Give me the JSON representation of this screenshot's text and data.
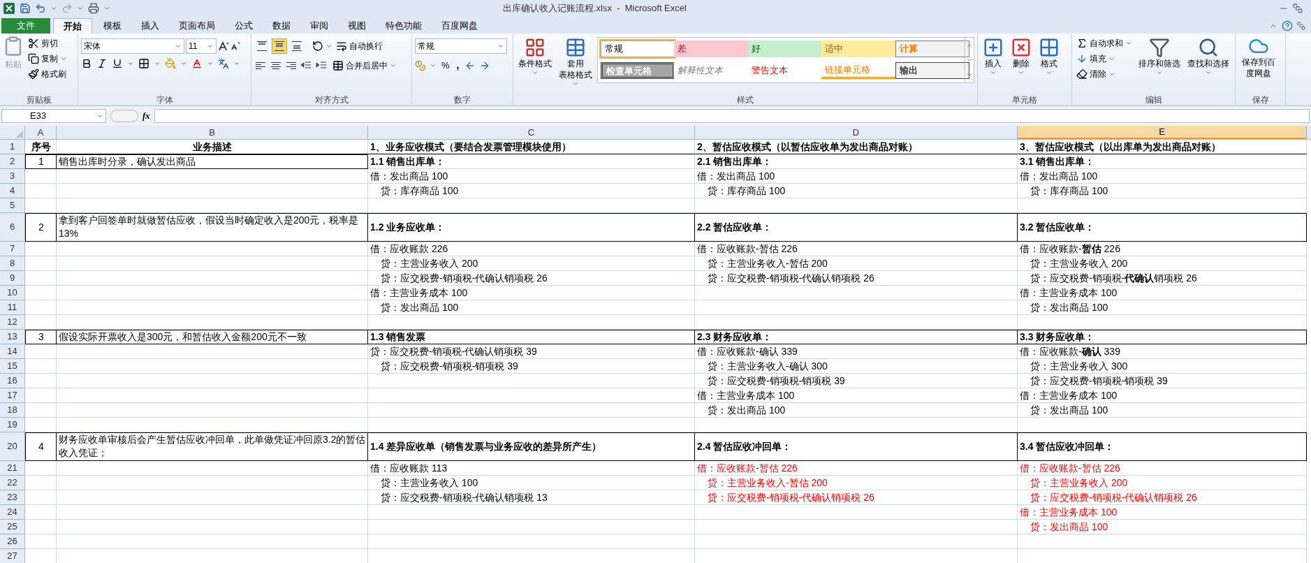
{
  "title_bar": {
    "title": "出库确认收入记账流程.xlsx  -  Microsoft Excel"
  },
  "tabs": [
    {
      "label": "文件",
      "kind": "file",
      "selected": false
    },
    {
      "label": "开始",
      "kind": "tab",
      "selected": true
    },
    {
      "label": "模板",
      "kind": "tab",
      "selected": false
    },
    {
      "label": "插入",
      "kind": "tab",
      "selected": false
    },
    {
      "label": "页面布局",
      "kind": "tab",
      "selected": false
    },
    {
      "label": "公式",
      "kind": "tab",
      "selected": false
    },
    {
      "label": "数据",
      "kind": "tab",
      "selected": false
    },
    {
      "label": "审阅",
      "kind": "tab",
      "selected": false
    },
    {
      "label": "视图",
      "kind": "tab",
      "selected": false
    },
    {
      "label": "特色功能",
      "kind": "tab",
      "selected": false
    },
    {
      "label": "百度网盘",
      "kind": "tab",
      "selected": false
    }
  ],
  "ribbon": {
    "clipboard": {
      "label": "剪贴板",
      "paste": "粘贴",
      "paste_disabled": true,
      "cut": "剪切",
      "copy": "复制",
      "format_painter": "格式刷"
    },
    "font": {
      "label": "字体",
      "font_name": "宋体",
      "font_size": "11"
    },
    "alignment": {
      "label": "对齐方式",
      "vertical_align": [
        {
          "kind": "top",
          "selected": false
        },
        {
          "kind": "middle",
          "selected": true
        },
        {
          "kind": "bottom",
          "selected": false
        }
      ],
      "wrap_text": "自动换行",
      "merge_center": "合并后居中"
    },
    "number": {
      "label": "数字",
      "format": "常规",
      "percent": "%",
      "comma": ","
    },
    "styles": {
      "label": "样式",
      "conditional_format": "条件格式",
      "table_format_line1": "套用",
      "table_format_line2": "表格格式",
      "cell_styles": [
        {
          "label": "常规",
          "kind": "normal",
          "selected": true
        },
        {
          "label": "差",
          "kind": "bad",
          "selected": false
        },
        {
          "label": "好",
          "kind": "good",
          "selected": false
        },
        {
          "label": "适中",
          "kind": "neutral",
          "selected": false
        },
        {
          "label": "计算",
          "kind": "calculation",
          "selected": false
        },
        {
          "label": "检查单元格",
          "kind": "check",
          "selected": false
        },
        {
          "label": "解释性文本",
          "kind": "explanatory",
          "selected": false
        },
        {
          "label": "警告文本",
          "kind": "warning",
          "selected": false
        },
        {
          "label": "链接单元格",
          "kind": "linked",
          "selected": false
        },
        {
          "label": "输出",
          "kind": "output",
          "selected": false
        }
      ]
    },
    "cells": {
      "label": "单元格",
      "insert": "插入",
      "delete": "删除",
      "format": "格式"
    },
    "editing": {
      "label": "编辑",
      "autosum": "自动求和",
      "fill": "填充",
      "clear": "清除",
      "sort_filter": "排序和筛选",
      "find_select": "查找和选择"
    },
    "save": {
      "label": "保存",
      "save_baidu": "保存到百度网盘"
    }
  },
  "formula_bar": {
    "name_box": "E33",
    "fx": "fx"
  },
  "sheet": {
    "columns": [
      {
        "label": "A",
        "selected": false
      },
      {
        "label": "B",
        "selected": false
      },
      {
        "label": "C",
        "selected": false
      },
      {
        "label": "D",
        "selected": false
      },
      {
        "label": "E",
        "selected": true
      }
    ],
    "rows": [
      {
        "n": "1",
        "kind": "title",
        "a": {
          "kind": "title",
          "text": "序号",
          "red": false
        },
        "b": {
          "kind": "title",
          "text": "业务描述",
          "red": false
        },
        "c": {
          "kind": "heading",
          "text": "1、业务应收模式（要结合发票管理模块使用）",
          "red": false
        },
        "d": {
          "kind": "heading",
          "text": "2、暂估应收模式（以暂估应收单为发出商品对账）",
          "red": false
        },
        "e": {
          "kind": "heading",
          "text": "3、暂估应收模式（以出库单为发出商品对账）",
          "red": false
        }
      },
      {
        "n": "2",
        "kind": "group",
        "a": {
          "kind": "number",
          "text": "1",
          "red": false
        },
        "b": {
          "kind": "text",
          "text": "销售出库时分录，确认发出商品",
          "red": false
        },
        "c": {
          "kind": "heading",
          "text": "1.1  销售出库单：",
          "red": false
        },
        "d": {
          "kind": "heading",
          "text": "2.1  销售出库单：",
          "red": false
        },
        "e": {
          "kind": "heading",
          "text": "3.1  销售出库单：",
          "red": false
        }
      },
      {
        "n": "3",
        "kind": "plain",
        "c": {
          "kind": "line",
          "text": "借：发出商品 100",
          "red": false
        },
        "d": {
          "kind": "line",
          "text": "借：发出商品 100",
          "red": false
        },
        "e": {
          "kind": "line",
          "text": "借：发出商品 100",
          "red": false
        }
      },
      {
        "n": "4",
        "kind": "plain",
        "c": {
          "kind": "subline",
          "text": "贷：库存商品 100",
          "red": false
        },
        "d": {
          "kind": "subline",
          "text": "贷：库存商品 100",
          "red": false
        },
        "e": {
          "kind": "subline",
          "text": "贷：库存商品 100",
          "red": false
        }
      },
      {
        "n": "5",
        "kind": "plain"
      },
      {
        "n": "6",
        "kind": "boxed_group",
        "a": {
          "kind": "number",
          "text": "2",
          "red": false
        },
        "b": {
          "kind": "text",
          "text": "拿到客户回签单时就做暂估应收，假设当时确定收入是200元，税率是13%",
          "red": false
        },
        "c": {
          "kind": "heading",
          "text": "1.2  业务应收单：",
          "red": false
        },
        "d": {
          "kind": "heading",
          "text": "2.2  暂估应收单：",
          "red": false
        },
        "e": {
          "kind": "heading",
          "text": "3.2  暂估应收单：",
          "red": false
        }
      },
      {
        "n": "7",
        "kind": "plain",
        "c": {
          "kind": "line",
          "text": "借：应收账款 226",
          "red": false
        },
        "d": {
          "kind": "line",
          "text": "借：应收账款-暂估 226",
          "red": false
        },
        "e": {
          "kind": "line",
          "text": "借：应收账款-**暂估** 226",
          "red": false
        }
      },
      {
        "n": "8",
        "kind": "plain",
        "c": {
          "kind": "subline",
          "text": "贷：主营业务收入 200",
          "red": false
        },
        "d": {
          "kind": "subline",
          "text": "贷：主营业务收入-暂估 200",
          "red": false
        },
        "e": {
          "kind": "subline",
          "text": "贷：主营业务收入 200",
          "red": false
        }
      },
      {
        "n": "9",
        "kind": "plain",
        "c": {
          "kind": "subline",
          "text": "贷：应交税费-销项税-代确认销项税 26",
          "red": false
        },
        "d": {
          "kind": "subline",
          "text": "贷：应交税费-销项税-代确认销项税 26",
          "red": false
        },
        "e": {
          "kind": "subline",
          "text": "贷：应交税费-销项税-**代确认**销项税 26",
          "red": false
        }
      },
      {
        "n": "10",
        "kind": "plain",
        "c": {
          "kind": "line",
          "text": "借：主营业务成本 100",
          "red": false
        },
        "e": {
          "kind": "line",
          "text": "借：主营业务成本 100",
          "red": false
        }
      },
      {
        "n": "11",
        "kind": "plain",
        "c": {
          "kind": "subline",
          "text": "贷：发出商品 100",
          "red": false
        },
        "e": {
          "kind": "subline",
          "text": "贷：发出商品 100",
          "red": false
        }
      },
      {
        "n": "12",
        "kind": "plain"
      },
      {
        "n": "13",
        "kind": "boxed_group",
        "a": {
          "kind": "number",
          "text": "3",
          "red": false
        },
        "b": {
          "kind": "text",
          "text": "假设实际开票收入是300元，和暂估收入金额200元不一致",
          "red": false
        },
        "c": {
          "kind": "heading",
          "text": "1.3  销售发票",
          "red": false
        },
        "d": {
          "kind": "heading",
          "text": "2.3  财务应收单：",
          "red": false
        },
        "e": {
          "kind": "heading",
          "text": "3.3  财务应收单：",
          "red": false
        }
      },
      {
        "n": "14",
        "kind": "plain",
        "c": {
          "kind": "line",
          "text": "贷：应交税费-销项税-代确认销项税 39",
          "red": false
        },
        "d": {
          "kind": "line",
          "text": "借：应收账款-确认 339",
          "red": false
        },
        "e": {
          "kind": "line",
          "text": "借：应收账款-**确认** 339",
          "red": false
        }
      },
      {
        "n": "15",
        "kind": "plain",
        "c": {
          "kind": "subline",
          "text": "贷：应交税费-销项税-销项税 39",
          "red": false
        },
        "d": {
          "kind": "subline",
          "text": "贷：主营业务收入-确认 300",
          "red": false
        },
        "e": {
          "kind": "subline",
          "text": "贷：主营业务收入 300",
          "red": false
        }
      },
      {
        "n": "16",
        "kind": "plain",
        "d": {
          "kind": "subline",
          "text": "贷：应交税费-销项税-销项税 39",
          "red": false
        },
        "e": {
          "kind": "subline",
          "text": "贷：应交税费-销项税-销项税 39",
          "red": false
        }
      },
      {
        "n": "17",
        "kind": "plain",
        "d": {
          "kind": "line",
          "text": "借：主营业务成本 100",
          "red": false
        },
        "e": {
          "kind": "line",
          "text": "借：主营业务成本 100",
          "red": false
        }
      },
      {
        "n": "18",
        "kind": "plain",
        "d": {
          "kind": "subline",
          "text": "贷：发出商品 100",
          "red": false
        },
        "e": {
          "kind": "subline",
          "text": "贷：发出商品 100",
          "red": false
        }
      },
      {
        "n": "19",
        "kind": "plain"
      },
      {
        "n": "20",
        "kind": "boxed_group",
        "a": {
          "kind": "number",
          "text": "4",
          "red": false
        },
        "b": {
          "kind": "text",
          "text": "财务应收单审核后会产生暂估应收冲回单，此单做凭证冲回原3.2的暂估收入凭证；",
          "red": false
        },
        "c": {
          "kind": "heading",
          "text": "1.4  差异应收单（销售发票与业务应收的差异所产生）",
          "red": false
        },
        "d": {
          "kind": "heading",
          "text": "2.4  暂估应收冲回单：",
          "red": false
        },
        "e": {
          "kind": "heading",
          "text": "3.4  暂估应收冲回单：",
          "red": false
        }
      },
      {
        "n": "21",
        "kind": "plain",
        "c": {
          "kind": "line",
          "text": "借：应收账款 113",
          "red": false
        },
        "d": {
          "kind": "line",
          "text": "借：应收账款-暂估 226",
          "red": true
        },
        "e": {
          "kind": "line",
          "text": "借：应收账款-暂估 226",
          "red": true
        }
      },
      {
        "n": "22",
        "kind": "plain",
        "c": {
          "kind": "subline",
          "text": "贷：主营业务收入 100",
          "red": false
        },
        "d": {
          "kind": "subline",
          "text": "贷：主营业务收入-暂估 200",
          "red": true
        },
        "e": {
          "kind": "subline",
          "text": "贷：主营业务收入 200",
          "red": true
        }
      },
      {
        "n": "23",
        "kind": "plain",
        "c": {
          "kind": "subline",
          "text": "贷：应交税费-销项税-代确认销项税 13",
          "red": false
        },
        "d": {
          "kind": "subline",
          "text": "贷：应交税费-销项税-代确认销项税 26",
          "red": true
        },
        "e": {
          "kind": "subline",
          "text": "贷：应交税费-销项税-代确认销项税 26",
          "red": true
        }
      },
      {
        "n": "24",
        "kind": "plain",
        "e": {
          "kind": "line",
          "text": "借：主营业务成本 100",
          "red": true
        }
      },
      {
        "n": "25",
        "kind": "plain",
        "e": {
          "kind": "subline",
          "text": "贷：发出商品 100",
          "red": true
        }
      },
      {
        "n": "26",
        "kind": "plain"
      },
      {
        "n": "27",
        "kind": "plain"
      }
    ]
  }
}
